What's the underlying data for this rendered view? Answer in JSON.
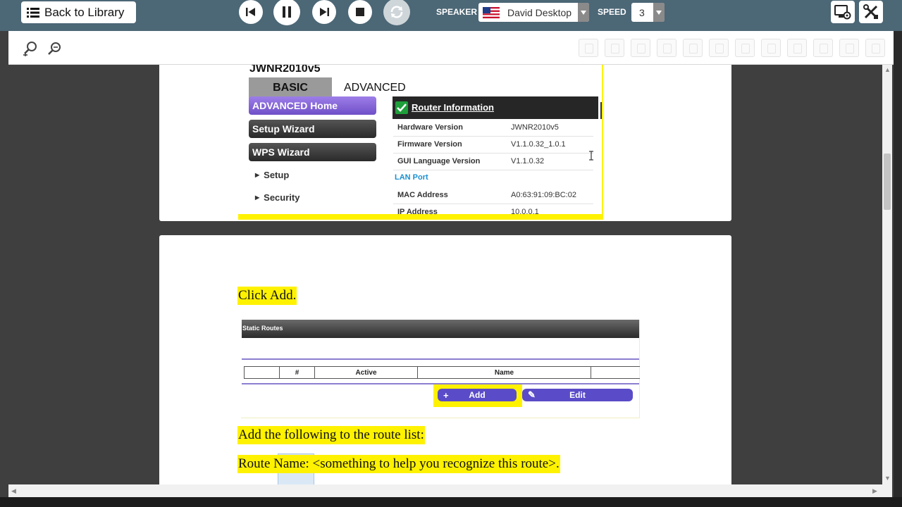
{
  "topbar": {
    "back_label": "Back to Library",
    "speaker_label": "SPEAKER",
    "speaker_value": "David Desktop",
    "speed_label": "SPEED",
    "speed_value": "3",
    "icons": [
      "list-icon",
      "skip-back-icon",
      "pause-icon",
      "skip-forward-icon",
      "stop-icon",
      "refresh-icon",
      "us-flag-icon",
      "screen-settings-icon",
      "tools-icon"
    ]
  },
  "toolbar2": {
    "icons": [
      "zoom-in-icon",
      "zoom-out-icon",
      "save-icon",
      "copy-icon",
      "cut-icon",
      "paste-icon",
      "undo-icon",
      "find-icon",
      "ruler-icon",
      "highlight-icon",
      "note-icon",
      "hand-icon",
      "check-icon",
      "trash-icon"
    ]
  },
  "router": {
    "model": "JWNR2010v5",
    "tabs": {
      "basic": "BASIC",
      "advanced": "ADVANCED"
    },
    "menu": [
      "ADVANCED Home",
      "Setup Wizard",
      "WPS Wizard"
    ],
    "submenu": [
      "Setup",
      "Security"
    ],
    "info_title": "Router Information",
    "rows": [
      {
        "k": "Hardware Version",
        "v": "JWNR2010v5"
      },
      {
        "k": "Firmware Version",
        "v": "V1.1.0.32_1.0.1"
      },
      {
        "k": "GUI Language Version",
        "v": "V1.1.0.32"
      }
    ],
    "lan_label": "LAN Port",
    "lan_rows": [
      {
        "k": "MAC Address",
        "v": "A0:63:91:09:BC:02"
      },
      {
        "k": "IP Address",
        "v": "10.0.0.1"
      }
    ]
  },
  "page2": {
    "click_add": "Click Add.",
    "static_routes": {
      "title": "Static Routes",
      "columns": [
        "",
        "#",
        "Active",
        "Name",
        ""
      ],
      "add_label": "Add",
      "edit_label": "Edit"
    },
    "add_following": "Add the following to the route list:",
    "route_name": "Route Name: <something to help you recognize this route>."
  },
  "colors": {
    "toolbar": "#4c6776",
    "highlight": "#fff200",
    "router_purple": "#7050c8",
    "button_purple": "#5a4cc8"
  }
}
